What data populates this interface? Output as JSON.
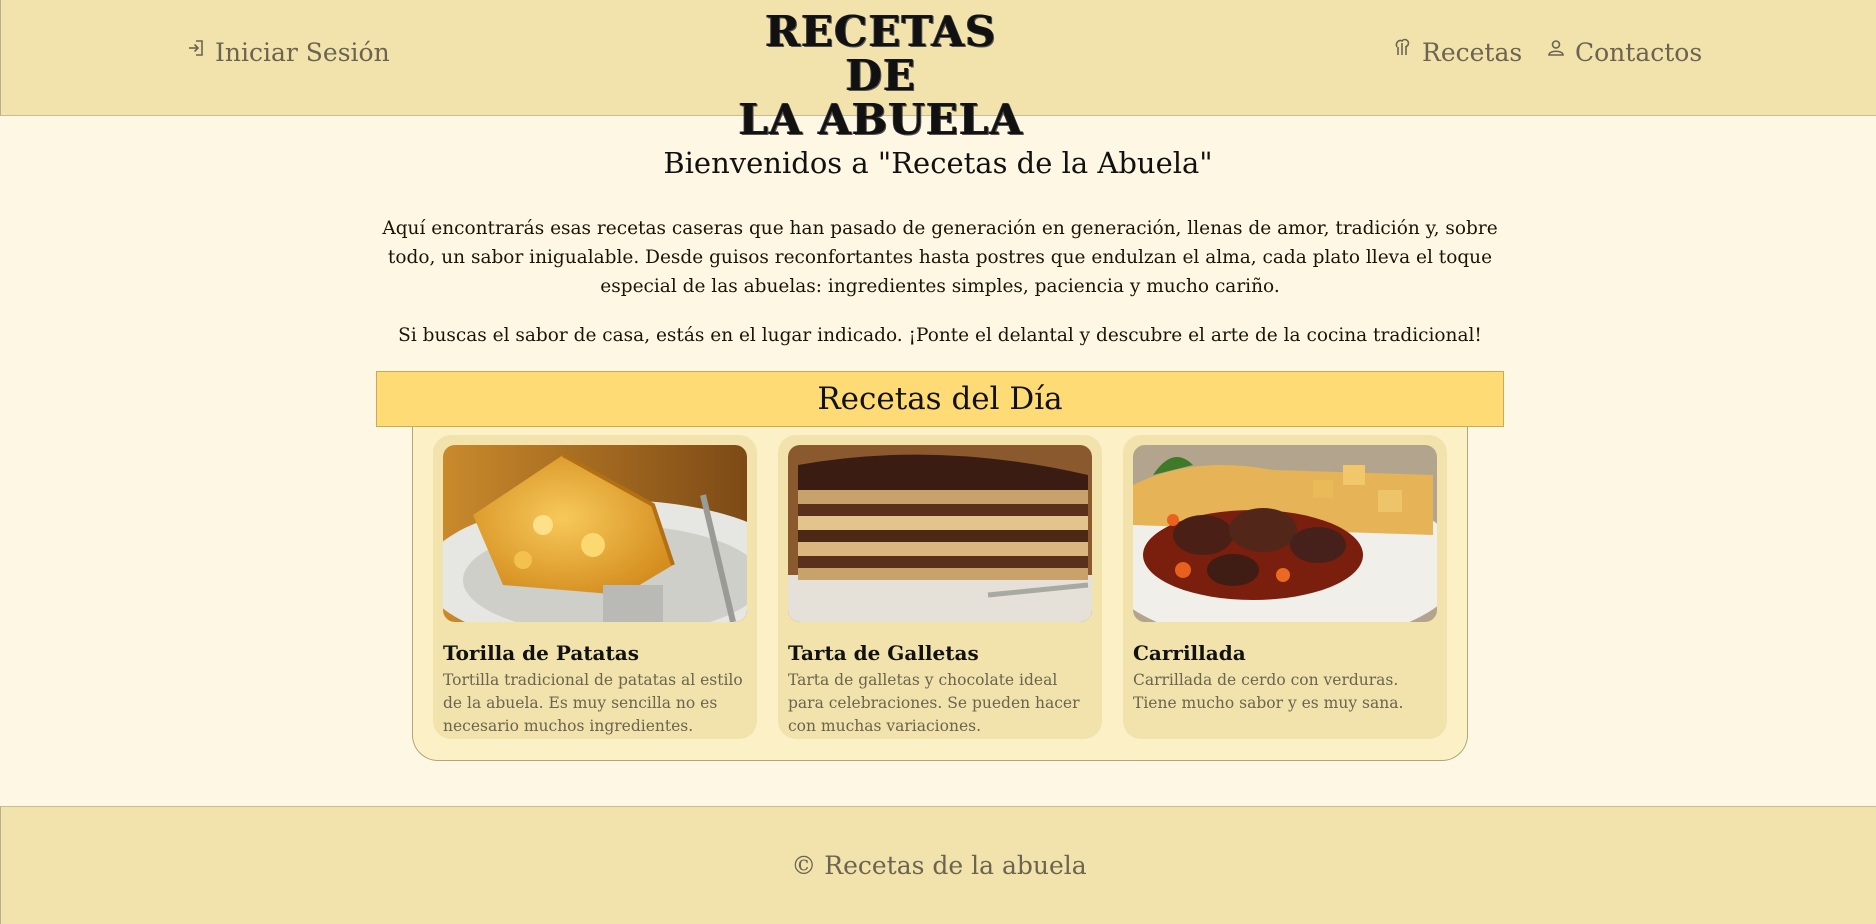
{
  "header": {
    "login_label": "Iniciar Sesión",
    "logo_line1": "RECETAS DE",
    "logo_line2": "LA ABUELA",
    "nav_recetas": "Recetas",
    "nav_contactos": "Contactos",
    "login_icon": "login-arrow-icon",
    "recetas_icon": "chef-hat-icon",
    "contactos_icon": "user-icon"
  },
  "welcome": {
    "title": "Bienvenidos a \"Recetas de la Abuela\"",
    "paragraph1": "Aquí encontrarás esas recetas caseras que han pasado de generación en generación, llenas de amor, tradición y, sobre todo, un sabor inigualable. Desde guisos reconfortantes hasta postres que endulzan el alma, cada plato lleva el toque especial de las abuelas: ingredientes simples, paciencia y mucho cariño.",
    "paragraph2": "Si buscas el sabor de casa, estás en el lugar indicado. ¡Ponte el delantal y descubre el arte de la cocina tradicional!"
  },
  "recipes_section": {
    "title": "Recetas del Día",
    "cards": [
      {
        "title": "Torilla de Patatas",
        "description": "Tortilla tradicional de patatas al estilo de la abuela. Es muy sencilla no es necesario muchos ingredientes."
      },
      {
        "title": "Tarta de Galletas",
        "description": "Tarta de galletas y chocolate ideal para celebraciones. Se pueden hacer con muchas variaciones."
      },
      {
        "title": "Carrillada",
        "description": "Carrillada de cerdo con verduras. Tiene mucho sabor y es muy sana."
      }
    ]
  },
  "footer": {
    "text": "© Recetas de la abuela"
  },
  "colors": {
    "header_bg": "#f2e3ac",
    "page_bg": "#fef7e4",
    "section_bar": "#fedb74",
    "card_bg": "#f2e3ac",
    "muted_text": "#6b6450"
  }
}
